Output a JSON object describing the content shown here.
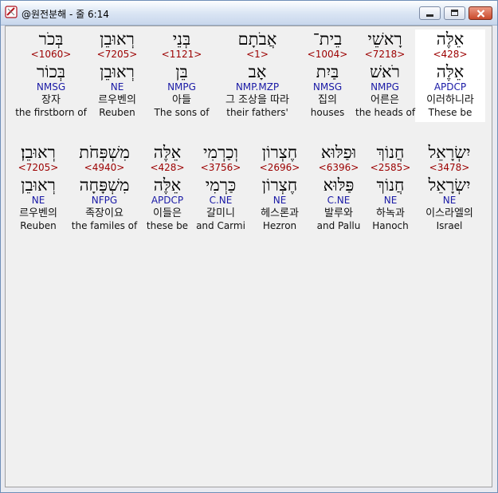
{
  "window": {
    "title": "@원전분해 - 줄 6:14",
    "icon": "scroll-app-icon",
    "colors": {
      "strong": "#9c0000",
      "morph": "#1a1aa6"
    }
  },
  "rows": [
    {
      "words": [
        {
          "hebrew": "אֵלֶּה",
          "strong": "<428>",
          "lemma": "אֵלֶּה",
          "morph": "APDCP",
          "korean": "이러하니라",
          "english": "These be",
          "highlight": true
        },
        {
          "hebrew": "רָאשֵׁי",
          "strong": "<7218>",
          "lemma": "רֹאשׁ",
          "morph": "NMPG",
          "korean": "어른은",
          "english": "the heads of"
        },
        {
          "hebrew": "בֵית־",
          "strong": "<1004>",
          "lemma": "בַּיִת",
          "morph": "NMSG",
          "korean": "집의",
          "english": "houses"
        },
        {
          "hebrew": "אֲבֹתָם",
          "strong": "<1>",
          "lemma": "אָב",
          "morph": "NMP.MZP",
          "korean": "그 조상을 따라",
          "english": "their fathers'"
        },
        {
          "hebrew": "בְּנֵי",
          "strong": "<1121>",
          "lemma": "בֵּן",
          "morph": "NMPG",
          "korean": "아들",
          "english": "The sons of"
        },
        {
          "hebrew": "רְאוּבֵן",
          "strong": "<7205>",
          "lemma": "רְאוּבֵן",
          "morph": "NE",
          "korean": "르우벤의",
          "english": "Reuben"
        },
        {
          "hebrew": "בְּכֹר",
          "strong": "<1060>",
          "lemma": "בְּכוֹר",
          "morph": "NMSG",
          "korean": "장자",
          "english": "the firstborn of"
        }
      ]
    },
    {
      "words": [
        {
          "hebrew": "יִשְׂרָאֵל",
          "strong": "<3478>",
          "lemma": "יִשְׂרָאֵל",
          "morph": "NE",
          "korean": "이스라엘의",
          "english": "Israel"
        },
        {
          "hebrew": "חֲנוֹךְ",
          "strong": "<2585>",
          "lemma": "חֲנוֹךְ",
          "morph": "NE",
          "korean": "하녹과",
          "english": "Hanoch"
        },
        {
          "hebrew": "וּפַלּוּא",
          "strong": "<6396>",
          "lemma": "פַּלּוּא",
          "morph": "C.NE",
          "korean": "발루와",
          "english": "and Pallu"
        },
        {
          "hebrew": "חֶצְרוֹן",
          "strong": "<2696>",
          "lemma": "חֶצְרוֹן",
          "morph": "NE",
          "korean": "헤스론과",
          "english": "Hezron"
        },
        {
          "hebrew": "וְכַרְמִי",
          "strong": "<3756>",
          "lemma": "כַּרְמִי",
          "morph": "C.NE",
          "korean": "갈미니",
          "english": "and Carmi"
        },
        {
          "hebrew": "אֵלֶּה",
          "strong": "<428>",
          "lemma": "אֵלֶּה",
          "morph": "APDCP",
          "korean": "이들은",
          "english": "these be"
        },
        {
          "hebrew": "מִשְׁפְּחֹת",
          "strong": "<4940>",
          "lemma": "מִשְׁפָּחָה",
          "morph": "NFPG",
          "korean": "족장이요",
          "english": "the familes of"
        },
        {
          "hebrew": "רְאוּבֵן׃",
          "strong": "<7205>",
          "lemma": "רְאוּבֵן",
          "morph": "NE",
          "korean": "르우벤의",
          "english": "Reuben"
        }
      ]
    }
  ]
}
